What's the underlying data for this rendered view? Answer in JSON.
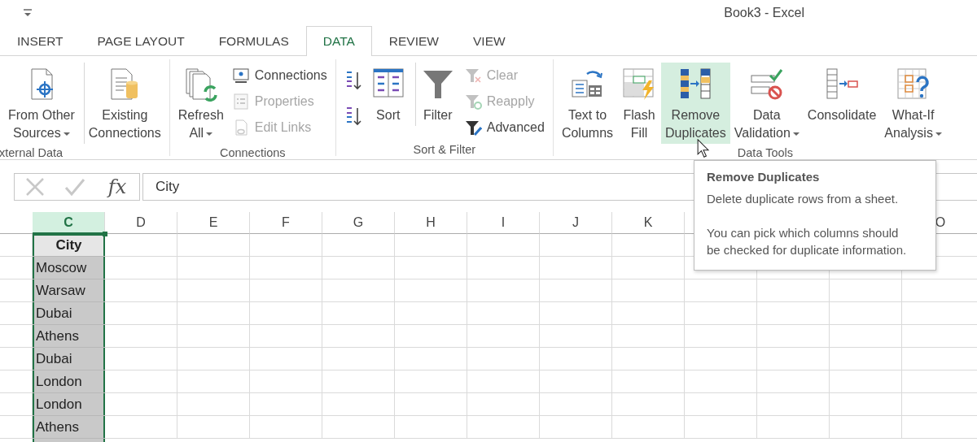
{
  "title_bar": {
    "title": "Book3 - Excel"
  },
  "tabs": [
    {
      "label": "INSERT",
      "selected": false
    },
    {
      "label": "PAGE LAYOUT",
      "selected": false
    },
    {
      "label": "FORMULAS",
      "selected": false
    },
    {
      "label": "DATA",
      "selected": true
    },
    {
      "label": "REVIEW",
      "selected": false
    },
    {
      "label": "VIEW",
      "selected": false
    }
  ],
  "ribbon": {
    "groups": [
      {
        "label": "xternal Data",
        "items": [
          {
            "kind": "source",
            "label": "From Other\nSources",
            "dropdown": true,
            "hovered": false
          },
          {
            "kind": "existing",
            "label": "Existing\nConnections",
            "hovered": false,
            "separated": true
          }
        ]
      },
      {
        "label": "Connections",
        "items": [
          {
            "kind": "refresh",
            "label": "Refresh\nAll",
            "dropdown": true,
            "hovered": false
          },
          {
            "buttons": [
              {
                "kind": "connections",
                "label": "Connections",
                "disabled": false
              },
              {
                "kind": "properties",
                "label": "Properties",
                "disabled": true
              },
              {
                "kind": "links",
                "label": "Edit Links",
                "disabled": true
              }
            ]
          }
        ]
      },
      {
        "label": "Sort & Filter",
        "items": [
          {
            "buttons": [
              {
                "kind": "az"
              },
              {
                "kind": "za"
              }
            ]
          },
          {
            "kind": "sort",
            "label": "Sort",
            "hovered": false
          },
          {
            "kind": "filter",
            "label": "Filter",
            "hovered": false,
            "separated": true
          },
          {
            "buttons": [
              {
                "kind": "clear",
                "label": "Clear",
                "disabled": true
              },
              {
                "kind": "reapply",
                "label": "Reapply",
                "disabled": true
              },
              {
                "kind": "advanced",
                "label": "Advanced",
                "disabled": false
              }
            ]
          }
        ]
      },
      {
        "label": "Data Tools",
        "items": [
          {
            "kind": "split",
            "label": "Text to\nColumns",
            "hovered": false
          },
          {
            "kind": "flash",
            "label": "Flash\nFill",
            "hovered": false
          },
          {
            "kind": "dedupe",
            "label": "Remove\nDuplicates",
            "hovered": true
          },
          {
            "kind": "validate",
            "label": "Data\nValidation",
            "dropdown": true,
            "hovered": false
          },
          {
            "kind": "consolidate",
            "label": "Consolidate",
            "hovered": false
          },
          {
            "kind": "whatif",
            "label": "What-If\nAnalysis",
            "dropdown": true,
            "hovered": false
          }
        ]
      }
    ]
  },
  "formula_bar": {
    "function_button": "fx",
    "value": "City"
  },
  "sheet": {
    "columns": [
      {
        "label": "C",
        "selected": true
      },
      {
        "label": "D",
        "selected": false
      },
      {
        "label": "E",
        "selected": false
      },
      {
        "label": "F",
        "selected": false
      },
      {
        "label": "G",
        "selected": false
      },
      {
        "label": "H",
        "selected": false
      },
      {
        "label": "I",
        "selected": false
      },
      {
        "label": "J",
        "selected": false
      },
      {
        "label": "K",
        "selected": false
      }
    ],
    "last_column": {
      "label": "O",
      "selected": false
    },
    "rows": [
      {
        "cell": "City",
        "active": true,
        "header": true
      },
      {
        "cell": "Moscow",
        "active": false,
        "header": false
      },
      {
        "cell": "Warsaw",
        "active": false,
        "header": false
      },
      {
        "cell": "Dubai",
        "active": false,
        "header": false
      },
      {
        "cell": "Athens",
        "active": false,
        "header": false
      },
      {
        "cell": "Dubai",
        "active": false,
        "header": false
      },
      {
        "cell": "London",
        "active": false,
        "header": false
      },
      {
        "cell": "London",
        "active": false,
        "header": false
      },
      {
        "cell": "Athens",
        "active": false,
        "header": false
      }
    ]
  },
  "tooltip": {
    "title": "Remove Duplicates",
    "paragraphs": [
      "Delete duplicate rows from a sheet.",
      "You can pick which columns should be checked for duplicate information."
    ]
  }
}
